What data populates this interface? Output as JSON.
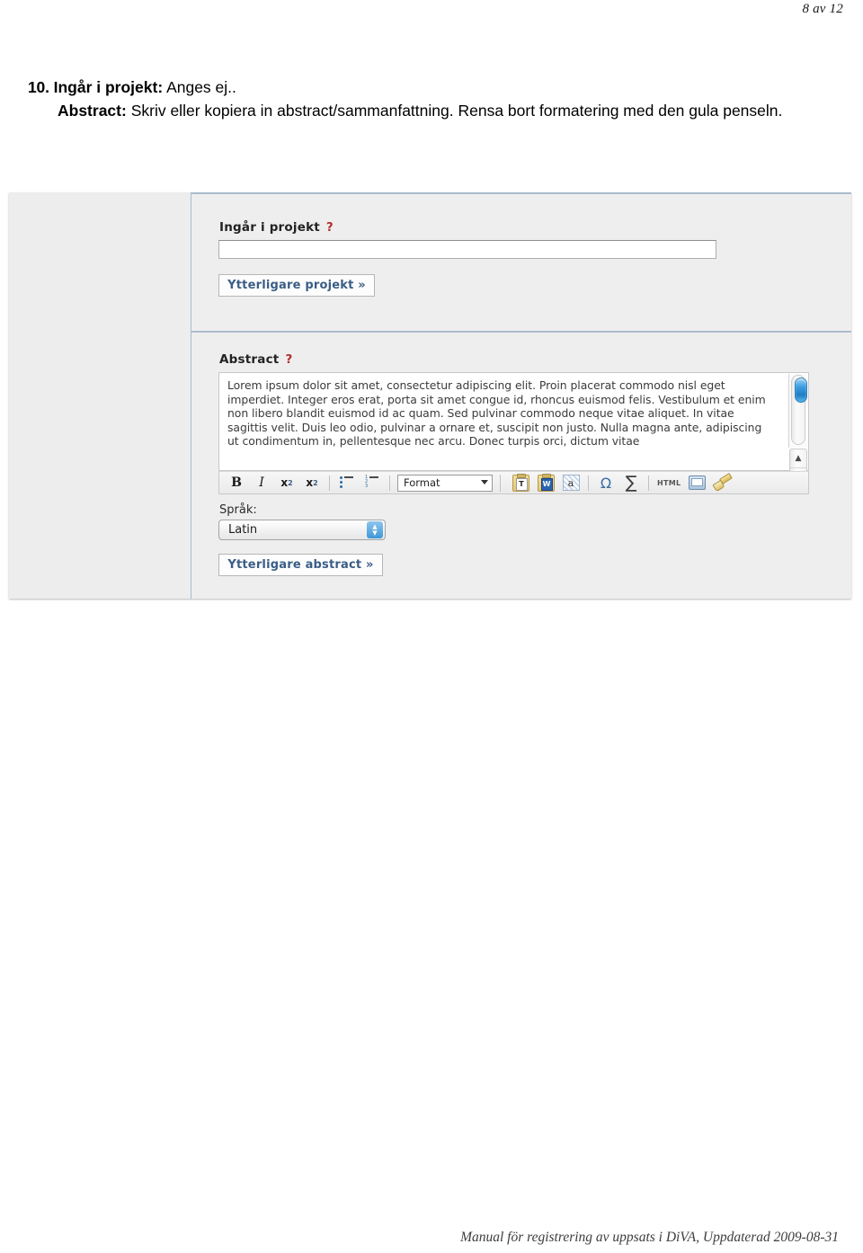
{
  "page": {
    "page_number": "8 av 12",
    "footer": "Manual för registrering av uppsats i DiVA, Uppdaterad 2009-08-31"
  },
  "instructions": {
    "item_number": "10.",
    "projekt_lead": "Ingår i projekt:",
    "projekt_text": "Anges ej..",
    "abstract_lead": "Abstract:",
    "abstract_text": "Skriv eller kopiera in abstract/sammanfattning. Rensa bort formatering med den gula penseln."
  },
  "screenshot": {
    "projekt_section": {
      "label": "Ingår i projekt",
      "help_marker": "?",
      "input_value": "",
      "more_button": "Ytterligare projekt »"
    },
    "abstract_section": {
      "label": "Abstract",
      "help_marker": "?",
      "editor_text": "Lorem ipsum dolor sit amet, consectetur adipiscing elit. Proin placerat commodo nisl eget imperdiet. Integer eros erat, porta sit amet congue id, rhoncus euismod felis. Vestibulum et enim non libero blandit euismod id ac quam. Sed pulvinar commodo neque vitae aliquet. In vitae sagittis velit. Duis leo odio, pulvinar a ornare et, suscipit non justo. Nulla magna ante, adipiscing ut condimentum in, pellentesque nec arcu. Donec turpis orci, dictum vitae",
      "toolbar": {
        "bold": "B",
        "italic": "I",
        "subscript_base": "x",
        "subscript_mark": "2",
        "superscript_base": "x",
        "superscript_mark": "2",
        "bulleted_list": "bulleted-list-icon",
        "numbered_list": "numbered-list-icon",
        "format_select_value": "Format",
        "paste_text": "T",
        "paste_word": "W",
        "remove_format": "a",
        "special_char": "Ω",
        "math_symbol": "∑",
        "html_source": "HTML",
        "maximize": "maximize-icon",
        "clean_brush": "brush-icon"
      },
      "language_label": "Språk:",
      "language_value": "Latin",
      "more_button": "Ytterligare abstract »"
    },
    "scrollbar": {
      "up_arrow": "▲",
      "down_arrow": "▼"
    }
  },
  "colors": {
    "accent_blue": "#3a5d86",
    "help_red": "#b03030",
    "section_border": "#a9bcce",
    "brush_yellow": "#e0c369"
  }
}
